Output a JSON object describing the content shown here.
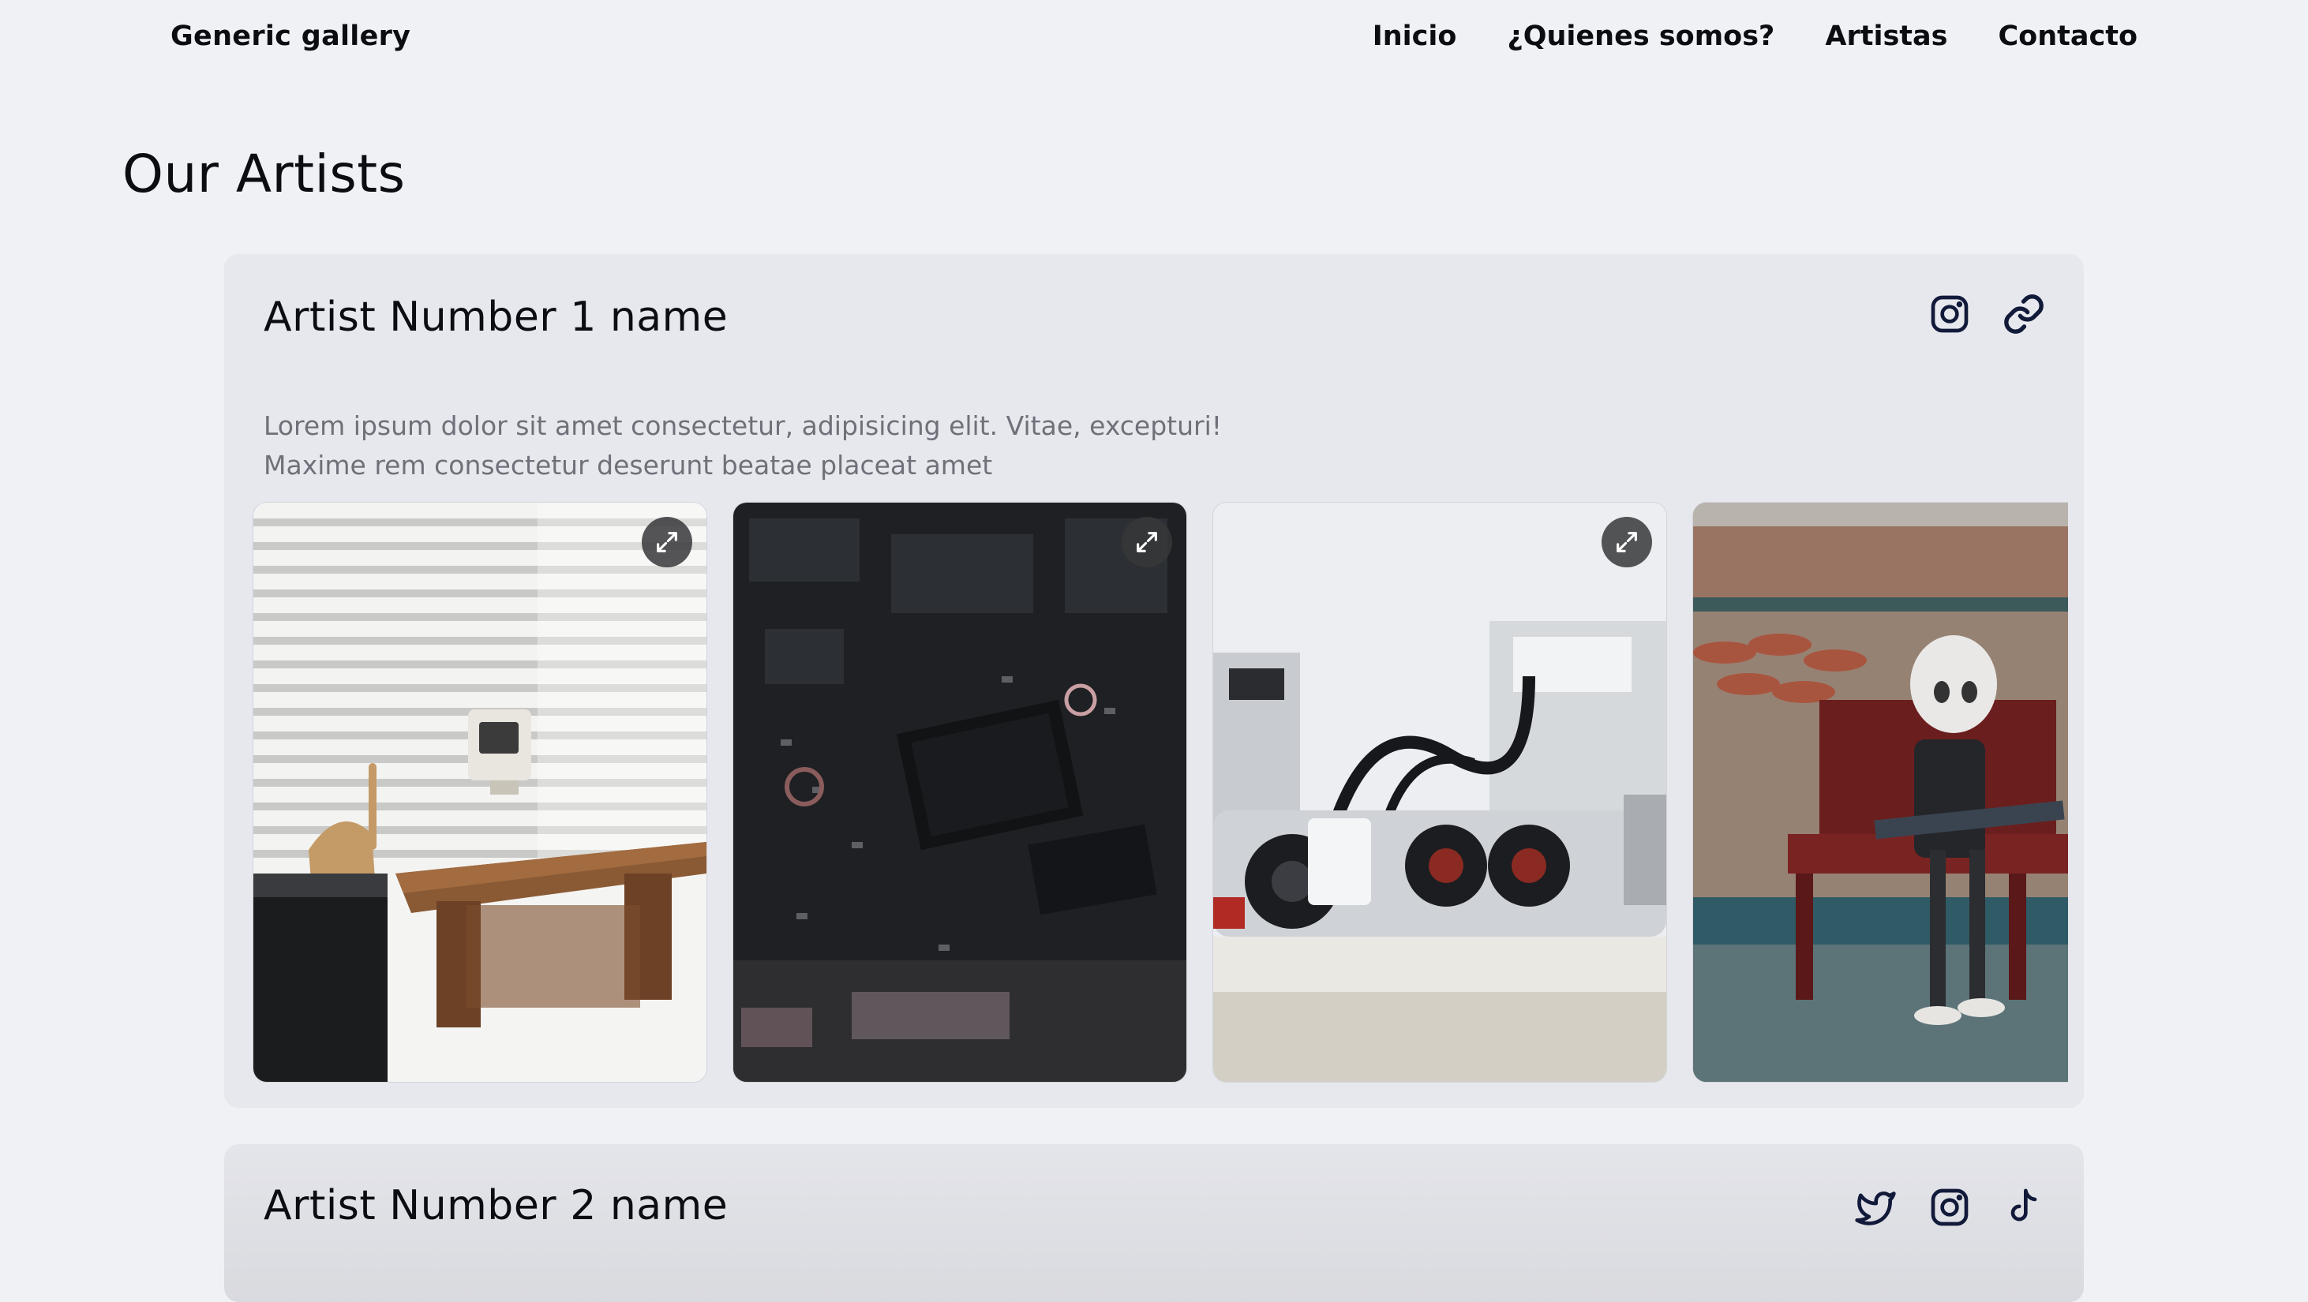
{
  "nav": {
    "brand": "Generic gallery",
    "links": [
      "Inicio",
      "¿Quienes somos?",
      "Artistas",
      "Contacto"
    ]
  },
  "page": {
    "title": "Our Artists"
  },
  "artists": [
    {
      "name": "Artist Number 1 name",
      "description": "Lorem ipsum dolor sit amet consectetur, adipisicing elit. Vitae, excepturi! Maxime rem consectetur deserunt beatae placeat amet",
      "socials": [
        "instagram-icon",
        "link-icon"
      ],
      "photos": [
        {
          "subject": "robot-on-desk"
        },
        {
          "subject": "circuit-board"
        },
        {
          "subject": "lego-robot"
        },
        {
          "subject": "robot-on-bench"
        }
      ]
    },
    {
      "name": "Artist Number 2 name",
      "socials": [
        "twitter-icon",
        "instagram-icon",
        "tiktok-icon"
      ]
    }
  ],
  "colors": {
    "background": "#f0f1f5",
    "card": "#e7e8ee",
    "text": "#0c0d12",
    "muted": "#6f7079",
    "icon": "#121a3a"
  }
}
